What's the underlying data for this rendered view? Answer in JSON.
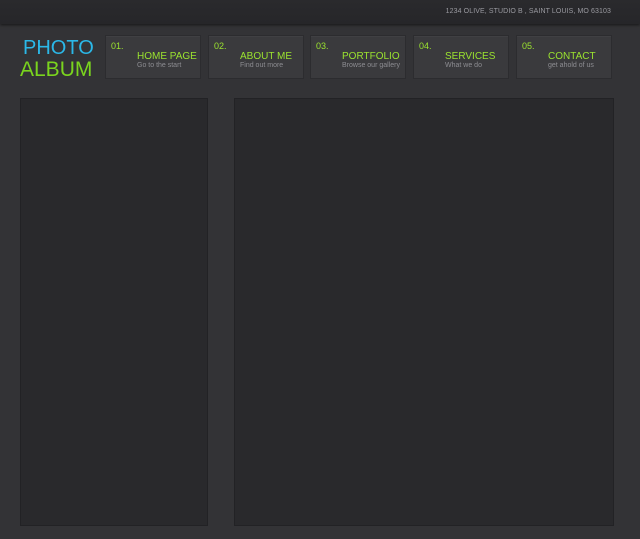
{
  "header": {
    "address": "1234 OLIVE, STUDIO B , SAINT LOUIS, MO 63103"
  },
  "logo": {
    "line1": "PHOTO",
    "line2": "ALBUM"
  },
  "nav": {
    "items": [
      {
        "num": "01.",
        "title": "HOME PAGE",
        "subtitle": "Go to the start"
      },
      {
        "num": "02.",
        "title": "ABOUT ME",
        "subtitle": "Find out more"
      },
      {
        "num": "03.",
        "title": "PORTFOLIO",
        "subtitle": "Browse our gallery"
      },
      {
        "num": "04.",
        "title": "SERVICES",
        "subtitle": "What we do"
      },
      {
        "num": "05.",
        "title": "CONTACT",
        "subtitle": "get ahold of us"
      }
    ]
  },
  "colors": {
    "background": "#333336",
    "panel": "#29292c",
    "logo_blue": "#2bb8e8",
    "logo_green": "#7ad41e",
    "nav_accent": "#9be32f"
  }
}
